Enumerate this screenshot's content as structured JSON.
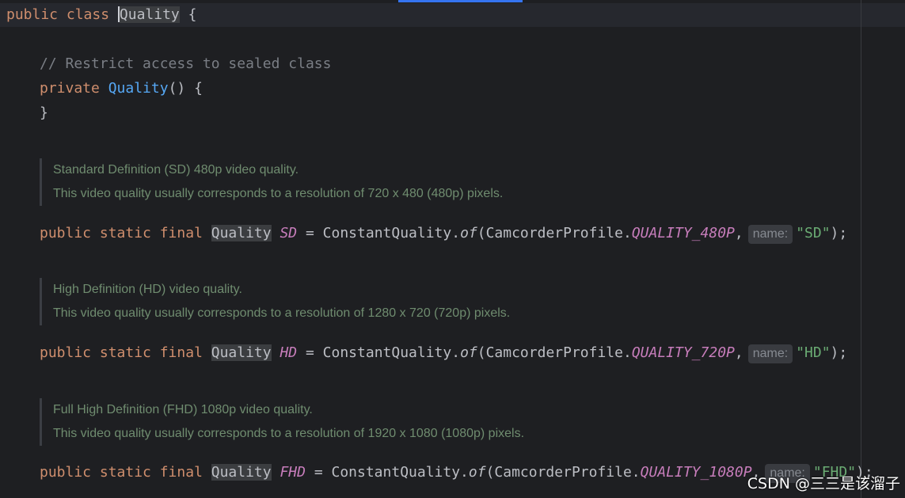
{
  "editor": {
    "class_decl": {
      "modifiers": "public class",
      "name_caret_first": "Q",
      "name_rest": "uality",
      "brace": "{"
    },
    "comment": "// Restrict access to sealed class",
    "ctor": {
      "modifier": "private",
      "name": "Quality",
      "tail": "() {",
      "close": "}"
    },
    "entries": [
      {
        "doc": [
          "Standard Definition (SD) 480p video quality.",
          "This video quality usually corresponds to a resolution of 720 x 480 (480p) pixels."
        ],
        "modifiers": "public static final",
        "type": "Quality",
        "name": "SD",
        "eq": "=",
        "call_prefix": "ConstantQuality.",
        "method": "of",
        "arg_prefix": "(CamcorderProfile.",
        "constant": "QUALITY_480P",
        "comma": ",",
        "hint": "name:",
        "str": "\"SD\"",
        "end": ");"
      },
      {
        "doc": [
          "High Definition (HD) video quality.",
          "This video quality usually corresponds to a resolution of 1280 x 720 (720p) pixels."
        ],
        "modifiers": "public static final",
        "type": "Quality",
        "name": "HD",
        "eq": "=",
        "call_prefix": "ConstantQuality.",
        "method": "of",
        "arg_prefix": "(CamcorderProfile.",
        "constant": "QUALITY_720P",
        "comma": ",",
        "hint": "name:",
        "str": "\"HD\"",
        "end": ");"
      },
      {
        "doc": [
          "Full High Definition (FHD) 1080p video quality.",
          "This video quality usually corresponds to a resolution of 1920 x 1080 (1080p) pixels."
        ],
        "modifiers": "public static final",
        "type": "Quality",
        "name": "FHD",
        "eq": "=",
        "call_prefix": "ConstantQuality.",
        "method": "of",
        "arg_prefix": "(CamcorderProfile.",
        "constant": "QUALITY_1080P",
        "comma": ",",
        "hint": "name:",
        "str": "\"FHD\"",
        "end": ");"
      }
    ]
  },
  "watermark": "CSDN @三三是该溜子",
  "colors": {
    "background": "#1e1f22",
    "keyword": "#cf8e6d",
    "function": "#56a8f5",
    "constant": "#c77dbb",
    "string": "#6aab73",
    "comment": "#7a7e85",
    "doc_text": "#6f8c6f",
    "accent": "#3574f0"
  }
}
